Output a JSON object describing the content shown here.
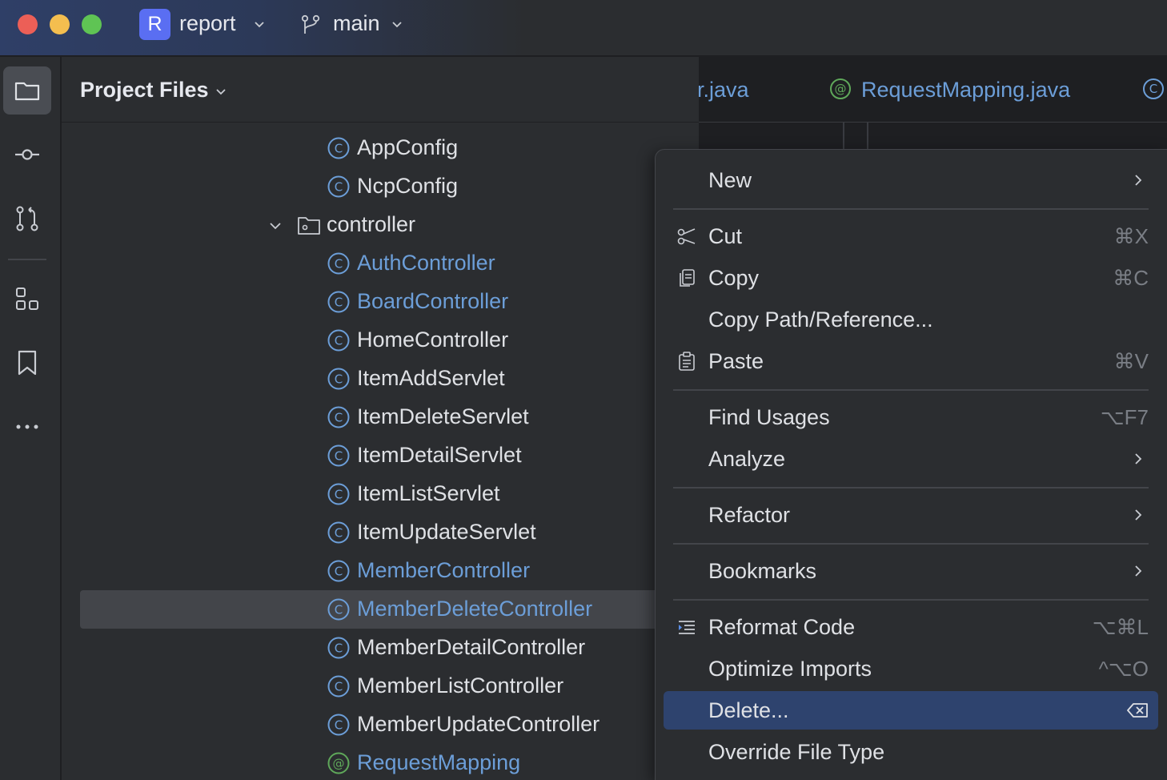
{
  "titlebar": {
    "project_badge": "R",
    "project_name": "report",
    "branch_name": "main"
  },
  "toolstrip": {
    "icons": [
      "folder-icon",
      "commit-icon",
      "pull-request-icon",
      "structure-icon",
      "bookmark-icon",
      "more-icon"
    ]
  },
  "panel": {
    "title": "Project Files",
    "tree": [
      {
        "label": "AppConfig",
        "kind": "class",
        "color": "default"
      },
      {
        "label": "NcpConfig",
        "kind": "class",
        "color": "default"
      },
      {
        "label": "controller",
        "kind": "folder",
        "expanded": true
      },
      {
        "label": "AuthController",
        "kind": "class",
        "color": "blue"
      },
      {
        "label": "BoardController",
        "kind": "class",
        "color": "blue"
      },
      {
        "label": "HomeController",
        "kind": "class",
        "color": "default"
      },
      {
        "label": "ItemAddServlet",
        "kind": "class",
        "color": "default"
      },
      {
        "label": "ItemDeleteServlet",
        "kind": "class",
        "color": "default"
      },
      {
        "label": "ItemDetailServlet",
        "kind": "class",
        "color": "default"
      },
      {
        "label": "ItemListServlet",
        "kind": "class",
        "color": "default"
      },
      {
        "label": "ItemUpdateServlet",
        "kind": "class",
        "color": "default"
      },
      {
        "label": "MemberController",
        "kind": "class",
        "color": "blue"
      },
      {
        "label": "MemberDeleteController",
        "kind": "class",
        "color": "blue",
        "selected": true
      },
      {
        "label": "MemberDetailController",
        "kind": "class",
        "color": "default"
      },
      {
        "label": "MemberListController",
        "kind": "class",
        "color": "default"
      },
      {
        "label": "MemberUpdateController",
        "kind": "class",
        "color": "default"
      },
      {
        "label": "RequestMapping",
        "kind": "annotation",
        "color": "blue"
      }
    ]
  },
  "editor": {
    "tabs": [
      {
        "label": "r.java"
      },
      {
        "label": "RequestMapping.java"
      }
    ]
  },
  "context_menu": {
    "items": [
      {
        "label": "New",
        "shortcut": "",
        "submenu": true,
        "icon": ""
      },
      {
        "label": "Cut",
        "shortcut": "⌘X",
        "submenu": false,
        "icon": "scissors-icon"
      },
      {
        "label": "Copy",
        "shortcut": "⌘C",
        "submenu": false,
        "icon": "copy-icon"
      },
      {
        "label": "Copy Path/Reference...",
        "shortcut": "",
        "submenu": false,
        "icon": ""
      },
      {
        "label": "Paste",
        "shortcut": "⌘V",
        "submenu": false,
        "icon": "clipboard-icon"
      },
      {
        "label": "Find Usages",
        "shortcut": "⌥F7",
        "submenu": false,
        "icon": ""
      },
      {
        "label": "Analyze",
        "shortcut": "",
        "submenu": true,
        "icon": ""
      },
      {
        "label": "Refactor",
        "shortcut": "",
        "submenu": true,
        "icon": ""
      },
      {
        "label": "Bookmarks",
        "shortcut": "",
        "submenu": true,
        "icon": ""
      },
      {
        "label": "Reformat Code",
        "shortcut": "⌥⌘L",
        "submenu": false,
        "icon": "reformat-icon"
      },
      {
        "label": "Optimize Imports",
        "shortcut": "^⌥O",
        "submenu": false,
        "icon": ""
      },
      {
        "label": "Delete...",
        "shortcut": "",
        "submenu": false,
        "icon": "",
        "highlighted": true
      },
      {
        "label": "Override File Type",
        "shortcut": "",
        "submenu": false,
        "icon": ""
      }
    ]
  },
  "colors": {
    "accent_blue": "#6c9ed8",
    "highlight": "#2e436e",
    "selection": "#43454a",
    "badge": "#5a6ef2"
  }
}
